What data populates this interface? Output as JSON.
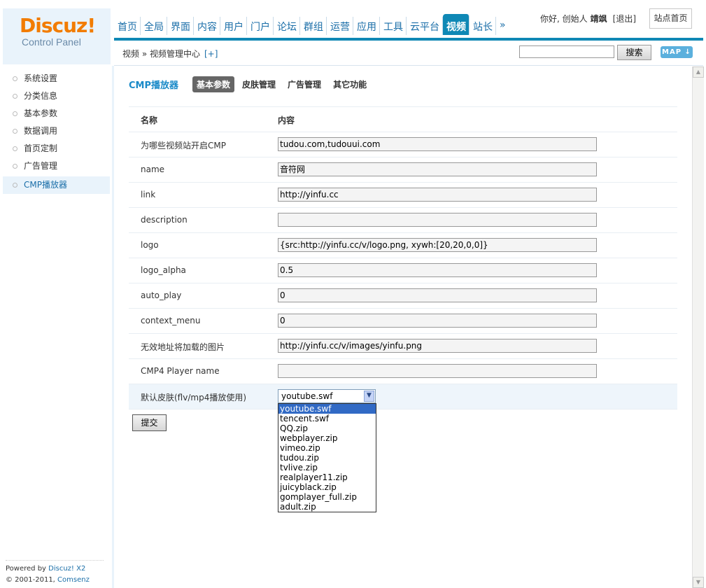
{
  "logo": {
    "brand": "Discuz!",
    "subtitle": "Control Panel"
  },
  "nav": {
    "items": [
      "首页",
      "全局",
      "界面",
      "内容",
      "用户",
      "门户",
      "论坛",
      "群组",
      "运营",
      "应用",
      "工具",
      "云平台",
      "视频",
      "站长",
      "»"
    ],
    "active_index": 12
  },
  "user": {
    "greeting": "你好, 创始人",
    "name": "靖飒",
    "logout": "[退出]",
    "site_home": "站点首页"
  },
  "subbar": {
    "breadcrumb": "视频 » 视频管理中心",
    "add_label": "[+]",
    "search_button": "搜索",
    "map_label": "MAP ↓"
  },
  "sidebar": {
    "items": [
      "系统设置",
      "分类信息",
      "基本参数",
      "数据调用",
      "首页定制",
      "广告管理",
      "CMP播放器"
    ],
    "active_index": 6,
    "footer_line1_prefix": "Powered by ",
    "footer_line1_brand": "Discuz! X2",
    "footer_line2_prefix": "© 2001-2011, ",
    "footer_line2_brand": "Comsenz Inc."
  },
  "main": {
    "title": "CMP播放器",
    "tabs": [
      "基本参数",
      "皮肤管理",
      "广告管理",
      "其它功能"
    ],
    "active_tab": 0,
    "header": {
      "name": "名称",
      "content": "内容"
    },
    "fields": [
      {
        "label": "为哪些视频站开启CMP",
        "value": "tudou.com,tudouui.com"
      },
      {
        "label": "name",
        "value": "音符网"
      },
      {
        "label": "link",
        "value": "http://yinfu.cc"
      },
      {
        "label": "description",
        "value": ""
      },
      {
        "label": "logo",
        "value": "{src:http://yinfu.cc/v/logo.png, xywh:[20,20,0,0]}"
      },
      {
        "label": "logo_alpha",
        "value": "0.5"
      },
      {
        "label": "auto_play",
        "value": "0"
      },
      {
        "label": "context_menu",
        "value": "0"
      },
      {
        "label": "无效地址将加载的图片",
        "value": "http://yinfu.cc/v/images/yinfu.png"
      },
      {
        "label": "CMP4 Player name",
        "value": ""
      }
    ],
    "skin": {
      "label": "默认皮肤(flv/mp4播放使用)",
      "selected": "youtube.swf",
      "options": [
        "youtube.swf",
        "tencent.swf",
        "QQ.zip",
        "webplayer.zip",
        "vimeo.zip",
        "tudou.zip",
        "tvlive.zip",
        "realplayer11.zip",
        "juicyblack.zip",
        "gomplayer_full.zip",
        "adult.zip"
      ]
    },
    "submit": "提交"
  }
}
